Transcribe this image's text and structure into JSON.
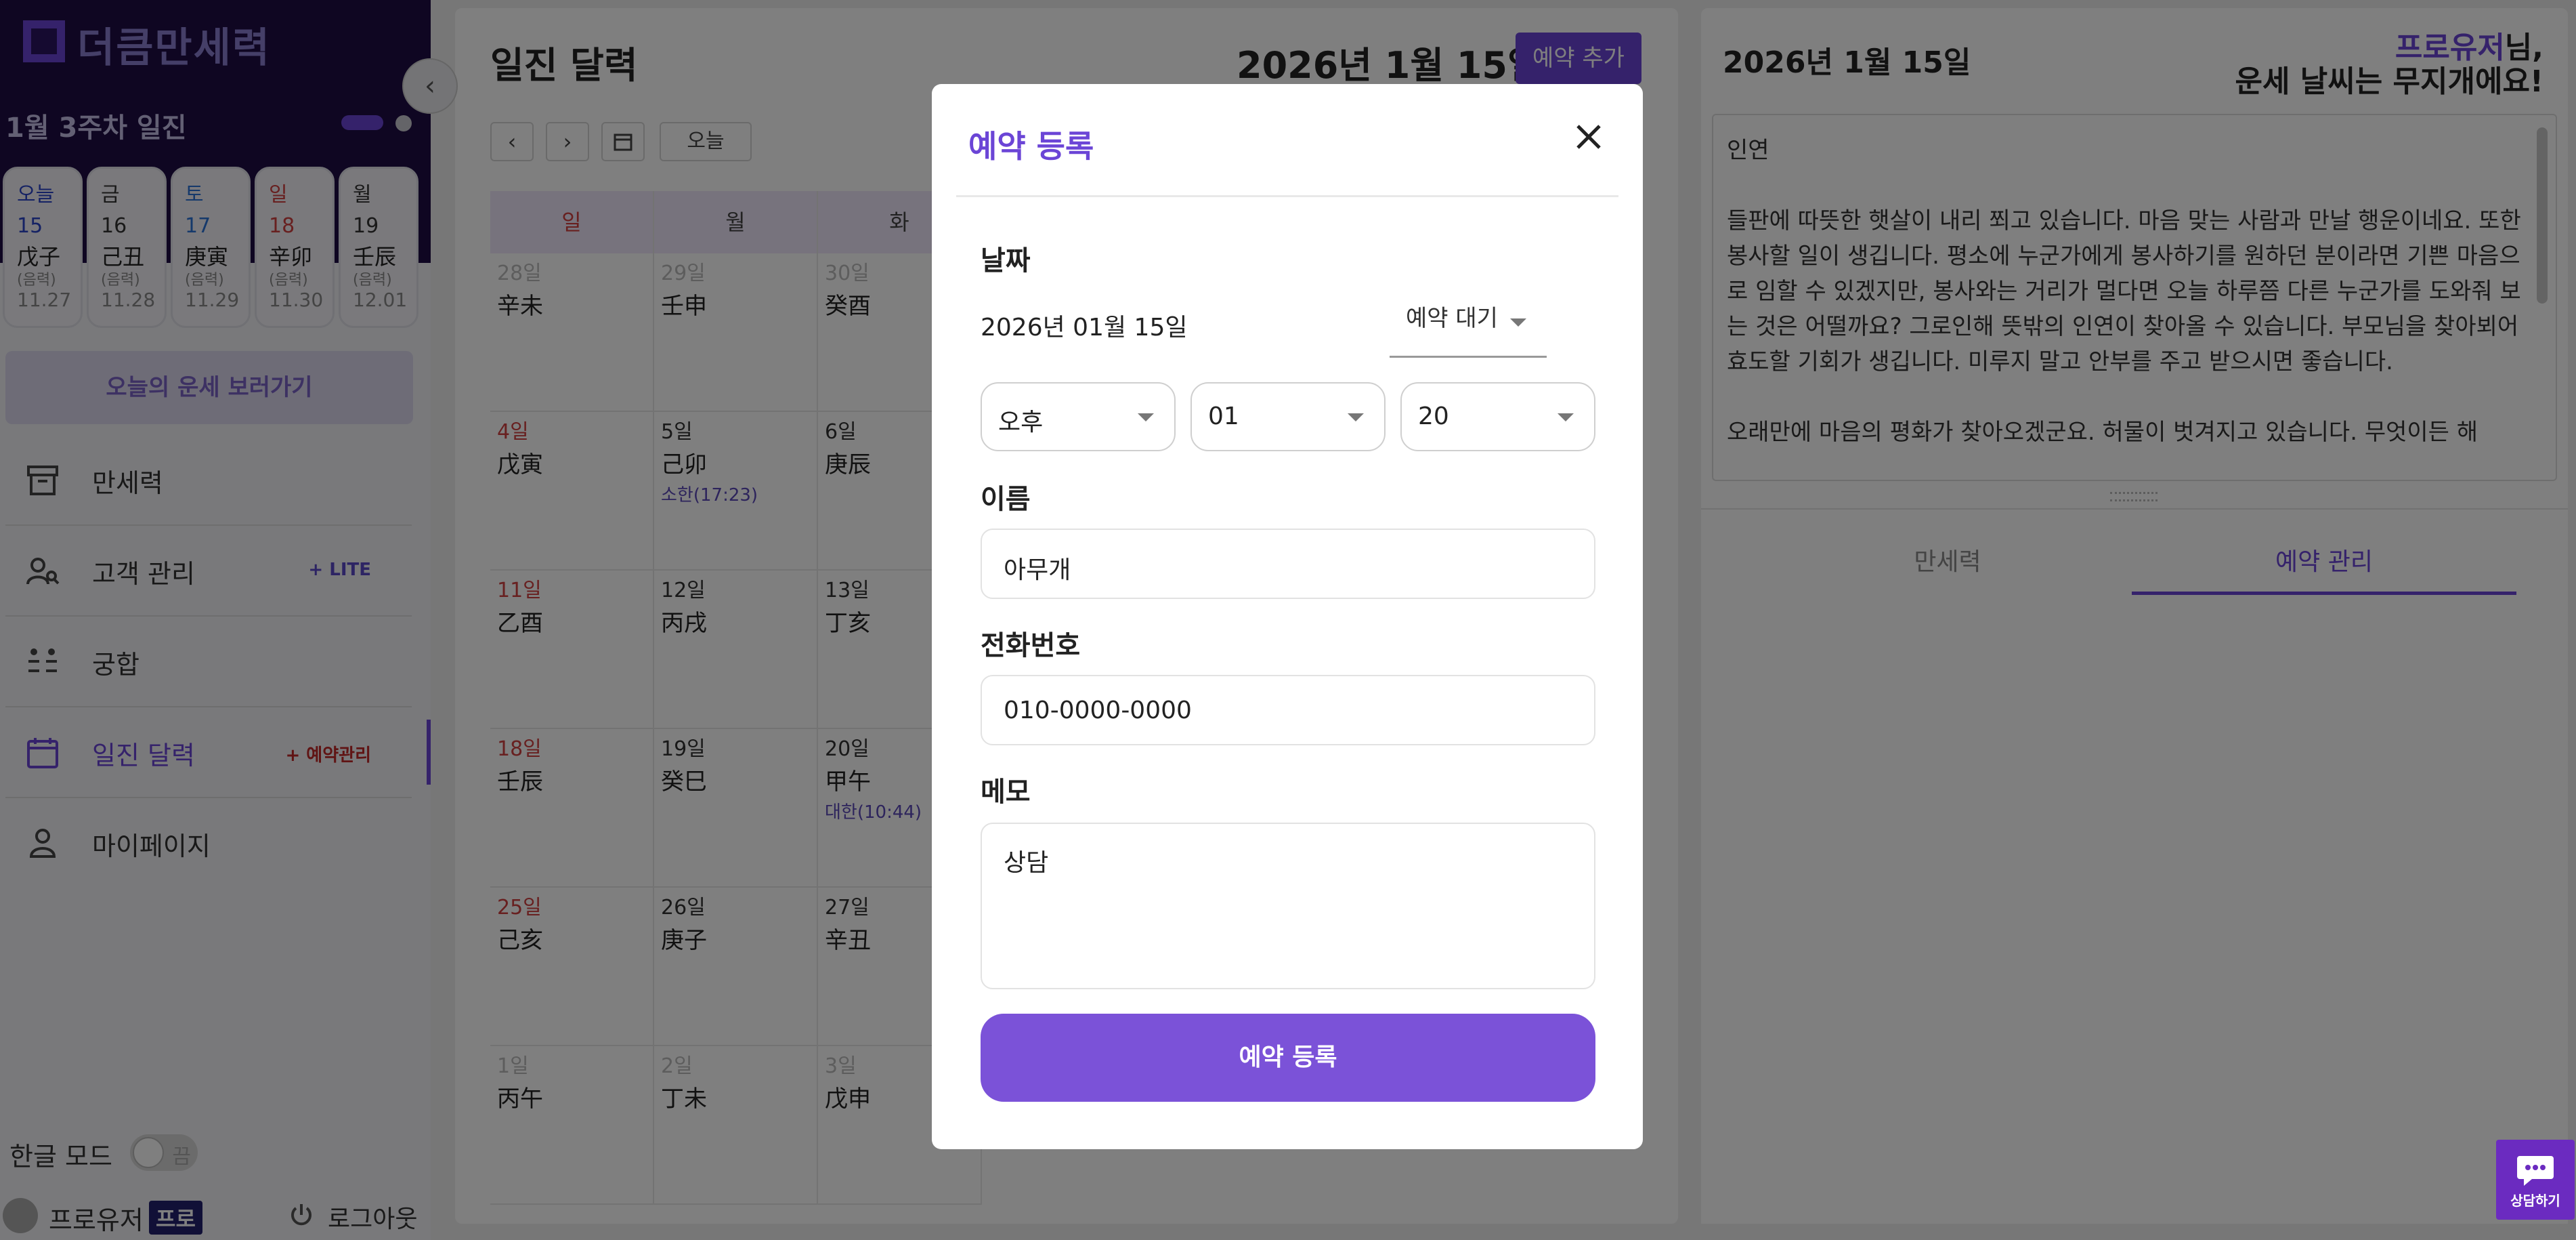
{
  "app": {
    "name": "더큼만세력"
  },
  "sidebar": {
    "week_title": "1월 3주차 일진",
    "days": [
      {
        "label": "오늘",
        "num": "15",
        "ganzi": "戊子",
        "lunar_label": "(음력)",
        "lunar": "11.27",
        "color": "#2a44c9"
      },
      {
        "label": "금",
        "num": "16",
        "ganzi": "己丑",
        "lunar_label": "(음력)",
        "lunar": "11.28",
        "color": "#333333"
      },
      {
        "label": "토",
        "num": "17",
        "ganzi": "庚寅",
        "lunar_label": "(음력)",
        "lunar": "11.29",
        "color": "#2a72d6"
      },
      {
        "label": "일",
        "num": "18",
        "ganzi": "辛卯",
        "lunar_label": "(음력)",
        "lunar": "11.30",
        "color": "#d04040"
      },
      {
        "label": "월",
        "num": "19",
        "ganzi": "壬辰",
        "lunar_label": "(음력)",
        "lunar": "12.01",
        "color": "#333333"
      }
    ],
    "fortune_button": "오늘의 운세 보러가기",
    "nav": [
      {
        "label": "만세력",
        "tag": "",
        "icon": "archive-icon"
      },
      {
        "label": "고객 관리",
        "tag": "+ LITE",
        "icon": "user-search-icon"
      },
      {
        "label": "궁합",
        "tag": "",
        "icon": "couple-icon"
      },
      {
        "label": "일진 달력",
        "tag": "+ 예약관리",
        "icon": "calendar-icon"
      },
      {
        "label": "마이페이지",
        "tag": "",
        "icon": "person-icon"
      }
    ],
    "hangul_mode_label": "한글 모드",
    "hangul_toggle": "끔",
    "user_name": "프로유저",
    "user_badge": "프로",
    "logout": "로그아웃"
  },
  "calendar": {
    "title": "일진 달력",
    "current_date": "2026년 1월 15일",
    "add_button": "예약 추가",
    "today_button": "오늘",
    "weekdays": [
      "일",
      "월",
      "화"
    ],
    "weeks": [
      [
        {
          "d": "28일",
          "g": "辛未",
          "t": ""
        },
        {
          "d": "29일",
          "g": "壬申",
          "t": ""
        },
        {
          "d": "30일",
          "g": "癸酉",
          "t": ""
        }
      ],
      [
        {
          "d": "4일",
          "g": "戊寅",
          "t": ""
        },
        {
          "d": "5일",
          "g": "己卯",
          "t": "소한(17:23)"
        },
        {
          "d": "6일",
          "g": "庚辰",
          "t": ""
        }
      ],
      [
        {
          "d": "11일",
          "g": "乙酉",
          "t": ""
        },
        {
          "d": "12일",
          "g": "丙戌",
          "t": ""
        },
        {
          "d": "13일",
          "g": "丁亥",
          "t": ""
        }
      ],
      [
        {
          "d": "18일",
          "g": "壬辰",
          "t": ""
        },
        {
          "d": "19일",
          "g": "癸巳",
          "t": ""
        },
        {
          "d": "20일",
          "g": "甲午",
          "t": "대한(10:44)"
        }
      ],
      [
        {
          "d": "25일",
          "g": "己亥",
          "t": ""
        },
        {
          "d": "26일",
          "g": "庚子",
          "t": ""
        },
        {
          "d": "27일",
          "g": "辛丑",
          "t": ""
        }
      ],
      [
        {
          "d": "1일",
          "g": "丙午",
          "t": ""
        },
        {
          "d": "2일",
          "g": "丁未",
          "t": ""
        },
        {
          "d": "3일",
          "g": "戊申",
          "t": ""
        }
      ]
    ]
  },
  "right_panel": {
    "date": "2026년 1월 15일",
    "greeting_name": "프로유저",
    "greeting_suffix": "님,",
    "greeting_line2": "운세 날씨는 무지개에요!",
    "fortune_heading": "인연",
    "fortune_body": "들판에 따뜻한 햇살이 내리 쬐고 있습니다. 마음 맞는 사람과 만날 행운이네요. 또한 봉사할 일이 생깁니다. 평소에 누군가에게 봉사하기를 원하던 분이라면 기쁜 마음으로 임할 수 있겠지만, 봉사와는 거리가 멀다면 오늘 하루쯤 다른 누군가를 도와줘 보는 것은 어떨까요? 그로인해 뜻밖의 인연이 찾아올 수 있습니다. 부모님을 찾아뵈어 효도할 기회가 생깁니다. 미루지 말고 안부를 주고 받으시면 좋습니다.",
    "fortune_more": "오래만에 마음의 평화가 찾아오겠군요. 허물이 벗겨지고 있습니다. 무엇이든 해",
    "tabs": [
      "만세력",
      "예약 관리"
    ]
  },
  "modal": {
    "title": "예약 등록",
    "date_label": "날짜",
    "date_value": "2026년 01월 15일",
    "status": "예약 대기",
    "ampm": "오후",
    "hour": "01",
    "minute": "20",
    "name_label": "이름",
    "name_value": "아무개",
    "phone_label": "전화번호",
    "phone_value": "010-0000-0000",
    "memo_label": "메모",
    "memo_value": "상담",
    "submit": "예약 등록"
  },
  "chat": {
    "label": "상담하기"
  }
}
